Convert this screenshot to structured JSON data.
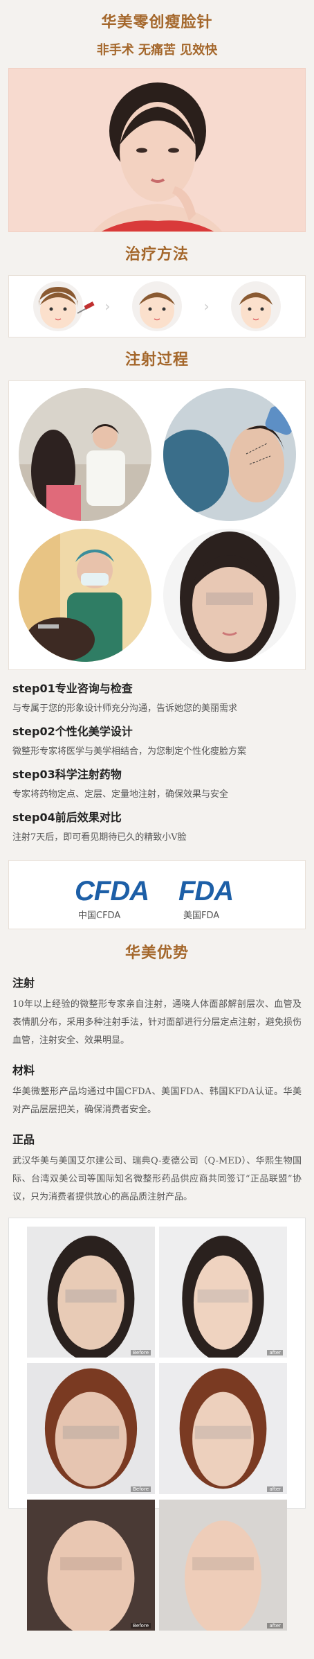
{
  "header": {
    "title": "华美零创瘦脸针",
    "subtitle": "非手术 无痛苦 见效快"
  },
  "sections": {
    "treatment": "治疗方法",
    "injection": "注射过程",
    "advantages": "华美优势"
  },
  "steps": [
    {
      "title": "step01专业咨询与检查",
      "text": "与专属于您的形象设计师充分沟通，告诉她您的美丽需求"
    },
    {
      "title": "step02个性化美学设计",
      "text": "微整形专家将医学与美学相结合，为您制定个性化瘦脸方案"
    },
    {
      "title": "step03科学注射药物",
      "text": "专家将药物定点、定层、定量地注射，确保效果与安全"
    },
    {
      "title": "step04前后效果对比",
      "text": "注射7天后，即可看见期待已久的精致小V脸"
    }
  ],
  "certs": {
    "cfda_logo": "CFDA",
    "fda_logo": "FDA",
    "cfda_label": "中国CFDA",
    "fda_label": "美国FDA"
  },
  "advantages": [
    {
      "title": "注射",
      "text": "10年以上经验的微整形专家亲自注射，通晓人体面部解剖层次、血管及表情肌分布，采用多种注射手法，针对面部进行分层定点注射，避免损伤血管，注射安全、效果明显。"
    },
    {
      "title": "材料",
      "text": "华美微整形产品均通过中国CFDA、美国FDA、韩国KFDA认证。华美对产品层层把关，确保消费者安全。"
    },
    {
      "title": "正品",
      "text": "武汉华美与美国艾尔建公司、瑞典Q-麦德公司（Q-MED）、华熙生物国际、台湾双美公司等国际知名微整形药品供应商共同签订“正品联盟”协议，只为消费者提供放心的高品质注射产品。"
    }
  ],
  "before_after": {
    "before_label": "Before",
    "after_label": "after"
  },
  "colors": {
    "accent": "#a4672b",
    "fda_blue": "#1d5fa7",
    "hero_bg": "#f7dacf"
  }
}
